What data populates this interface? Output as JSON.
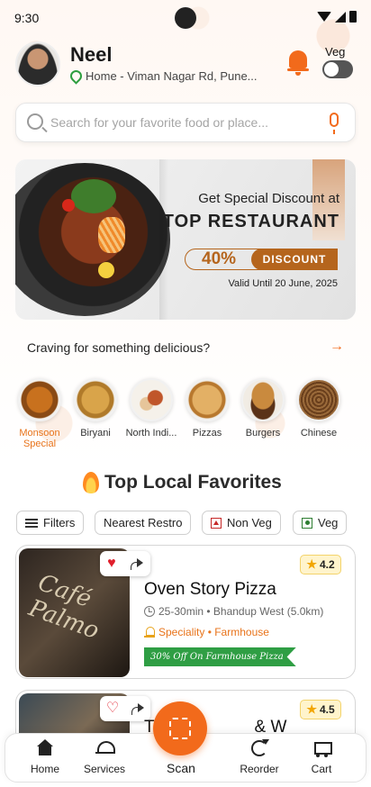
{
  "status_bar": {
    "time": "9:30"
  },
  "header": {
    "user_name": "Neel",
    "location": "Home - Viman Nagar Rd, Pune...",
    "veg_label": "Veg",
    "veg_toggle_on": false
  },
  "search": {
    "placeholder": "Search for your favorite food or place..."
  },
  "banner": {
    "subtitle": "Get Special Discount at",
    "title": "TOP RESTAURANT",
    "discount_percent": "40%",
    "discount_label": "DISCOUNT",
    "valid_until": "Valid Until 20 June, 2025"
  },
  "craving": {
    "text": "Craving for something delicious?",
    "arrow": "→"
  },
  "categories": [
    {
      "label": "Monsoon Special",
      "active": true,
      "color": "#c8711e"
    },
    {
      "label": "Biryani",
      "active": false,
      "color": "#d9a44a"
    },
    {
      "label": "North Indi...",
      "active": false,
      "color": "#c0562a"
    },
    {
      "label": "Pizzas",
      "active": false,
      "color": "#e3b065"
    },
    {
      "label": "Burgers",
      "active": false,
      "color": "#a8662e"
    },
    {
      "label": "Chinese",
      "active": false,
      "color": "#7a4a2a"
    }
  ],
  "section": {
    "title": "Top Local Favorites"
  },
  "filters": {
    "filters_label": "Filters",
    "nearest_label": "Nearest Restro",
    "nonveg_label": "Non Veg",
    "veg_label": "Veg"
  },
  "restaurants": [
    {
      "name": "Oven Story Pizza",
      "rating": "4.2",
      "time_distance": "25-30min • Bhandup West (5.0km)",
      "speciality": "Speciality • Farmhouse",
      "offer": "30% Off On Farmhouse Pizza",
      "sign_text": "Café Palmo",
      "favorited": true
    },
    {
      "name": "T__________ & W____",
      "rating": "4.5",
      "favorited": false
    }
  ],
  "bottom_nav": {
    "home": "Home",
    "services": "Services",
    "scan": "Scan",
    "reorder": "Reorder",
    "cart": "Cart"
  },
  "colors": {
    "accent": "#f26a1b",
    "offer_green": "#2f9e44",
    "banner_brown": "#b5651d"
  }
}
